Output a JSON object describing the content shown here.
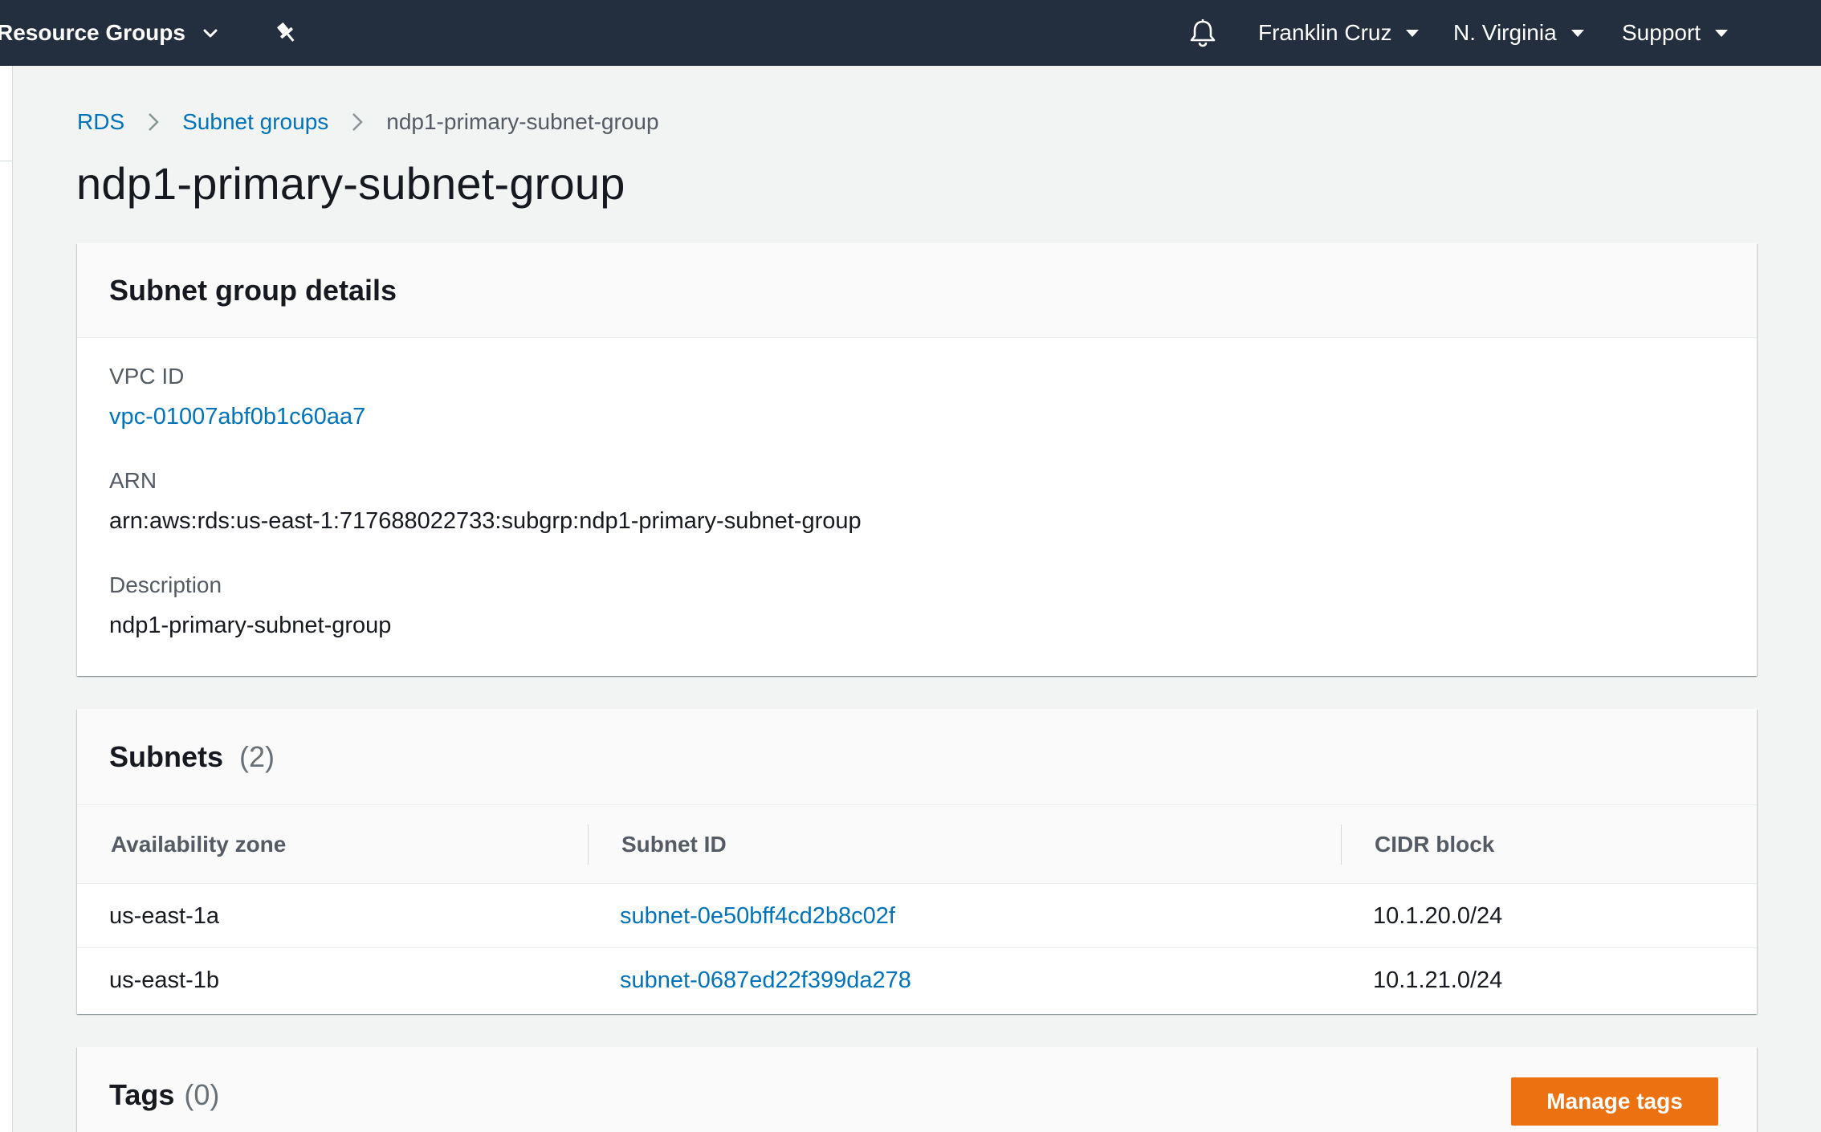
{
  "topnav": {
    "resource_groups": "Resource Groups",
    "user": "Franklin Cruz",
    "region": "N. Virginia",
    "support": "Support"
  },
  "breadcrumb": {
    "root": "RDS",
    "section": "Subnet groups",
    "current": "ndp1-primary-subnet-group"
  },
  "page": {
    "title": "ndp1-primary-subnet-group"
  },
  "details": {
    "heading": "Subnet group details",
    "vpc_label": "VPC ID",
    "vpc_value": "vpc-01007abf0b1c60aa7",
    "arn_label": "ARN",
    "arn_value": "arn:aws:rds:us-east-1:717688022733:subgrp:ndp1-primary-subnet-group",
    "description_label": "Description",
    "description_value": "ndp1-primary-subnet-group"
  },
  "subnets": {
    "heading": "Subnets",
    "count": "(2)",
    "columns": [
      "Availability zone",
      "Subnet ID",
      "CIDR block"
    ],
    "rows": [
      {
        "az": "us-east-1a",
        "subnet_id": "subnet-0e50bff4cd2b8c02f",
        "cidr": "10.1.20.0/24"
      },
      {
        "az": "us-east-1b",
        "subnet_id": "subnet-0687ed22f399da278",
        "cidr": "10.1.21.0/24"
      }
    ]
  },
  "tags": {
    "heading": "Tags",
    "count": "(0)",
    "manage_button": "Manage tags"
  },
  "colors": {
    "nav_bg": "#232f3e",
    "link": "#0073bb",
    "primary_button": "#ec7211",
    "page_bg": "#f2f3f3"
  },
  "icons": [
    "chevron-down-icon",
    "pin-icon",
    "bell-icon",
    "chevron-right-icon"
  ]
}
